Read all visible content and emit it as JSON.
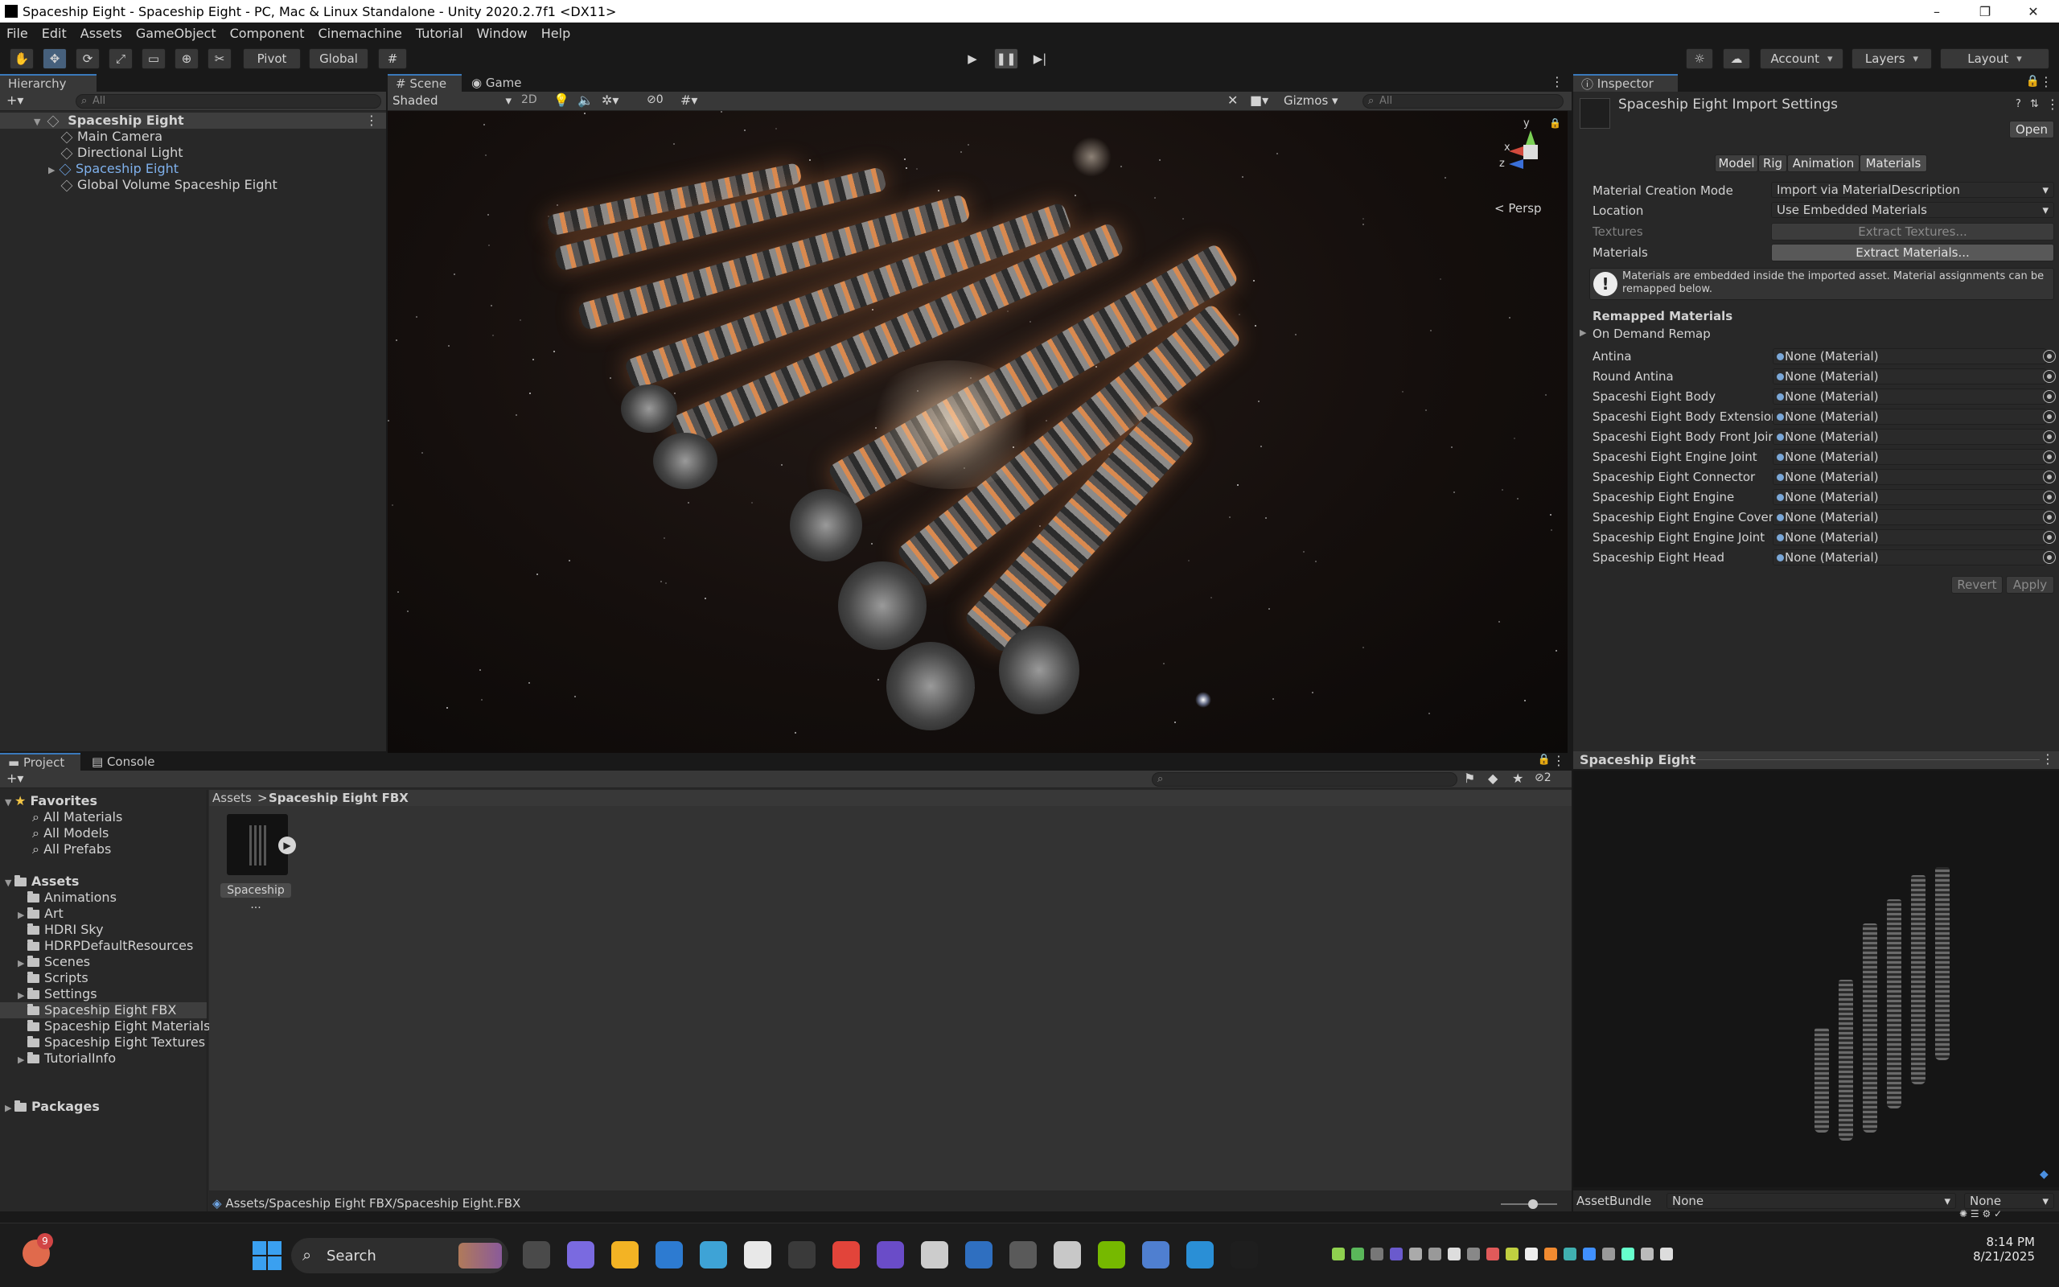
{
  "window": {
    "title": "Spaceship Eight - Spaceship Eight - PC, Mac & Linux Standalone - Unity 2020.2.7f1 <DX11>",
    "minimize": "–",
    "maximize": "❐",
    "close": "✕"
  },
  "menu": [
    "File",
    "Edit",
    "Assets",
    "GameObject",
    "Component",
    "Cinemachine",
    "Tutorial",
    "Window",
    "Help"
  ],
  "toolbar": {
    "pivot": "Pivot",
    "global": "Global",
    "account": "Account",
    "layers": "Layers",
    "layout": "Layout"
  },
  "hierarchy": {
    "tab": "Hierarchy",
    "search_placeholder": "All",
    "scene": "Spaceship Eight",
    "items": [
      "Main Camera",
      "Directional Light",
      "Spaceship Eight",
      "Global Volume Spaceship Eight"
    ]
  },
  "scene": {
    "tab_scene": "Scene",
    "tab_game": "Game",
    "shading": "Shaded",
    "mode2d": "2D",
    "hidden_count": "0",
    "gizmos": "Gizmos",
    "search_placeholder": "All",
    "persp": "< Persp",
    "axis_y": "y",
    "axis_x": "x",
    "axis_z": "z"
  },
  "inspector": {
    "tab": "Inspector",
    "title": "Spaceship Eight Import Settings",
    "open": "Open",
    "tabs": [
      "Model",
      "Rig",
      "Animation",
      "Materials"
    ],
    "creation_mode_label": "Material Creation Mode",
    "creation_mode_value": "Import via MaterialDescription",
    "location_label": "Location",
    "location_value": "Use Embedded Materials",
    "textures_label": "Textures",
    "extract_textures": "Extract Textures...",
    "materials_label": "Materials",
    "extract_materials": "Extract Materials...",
    "help_text": "Materials are embedded inside the imported asset. Material assignments can be remapped below.",
    "remapped_header": "Remapped Materials",
    "on_demand": "On Demand Remap",
    "remaps": [
      {
        "name": "Antina",
        "value": "None (Material)"
      },
      {
        "name": "Round Antina",
        "value": "None (Material)"
      },
      {
        "name": "Spaceshi Eight Body",
        "value": "None (Material)"
      },
      {
        "name": "Spaceshi Eight Body Extension",
        "value": "None (Material)"
      },
      {
        "name": "Spaceshi Eight Body Front Joir",
        "value": "None (Material)"
      },
      {
        "name": "Spaceshi Eight Engine Joint",
        "value": "None (Material)"
      },
      {
        "name": "Spaceship Eight Connector",
        "value": "None (Material)"
      },
      {
        "name": "Spaceship Eight Engine",
        "value": "None (Material)"
      },
      {
        "name": "Spaceship Eight Engine Cover",
        "value": "None (Material)"
      },
      {
        "name": "Spaceship Eight Engine Joint",
        "value": "None (Material)"
      },
      {
        "name": "Spaceship Eight Head",
        "value": "None (Material)"
      }
    ],
    "revert": "Revert",
    "apply": "Apply"
  },
  "preview": {
    "title": "Spaceship Eight",
    "assetbundle_label": "AssetBundle",
    "assetbundle_value": "None",
    "variant_value": "None"
  },
  "project": {
    "tab_project": "Project",
    "tab_console": "Console",
    "hidden_count": "2",
    "favorites_label": "Favorites",
    "favorites": [
      "All Materials",
      "All Models",
      "All Prefabs"
    ],
    "assets_label": "Assets",
    "folders": [
      "Animations",
      "Art",
      "HDRI Sky",
      "HDRPDefaultResources",
      "Scenes",
      "Scripts",
      "Settings",
      "Spaceship Eight FBX",
      "Spaceship Eight Materials",
      "Spaceship Eight Textures",
      "TutorialInfo"
    ],
    "packages_label": "Packages",
    "breadcrumb_root": "Assets",
    "breadcrumb_sep": ">",
    "breadcrumb_current": "Spaceship Eight FBX",
    "asset_label": "Spaceship ...",
    "status_path": "Assets/Spaceship Eight FBX/Spaceship Eight.FBX"
  },
  "taskbar": {
    "search": "Search",
    "time": "8:14 PM",
    "date": "8/21/2025",
    "weather_badge": "9"
  }
}
